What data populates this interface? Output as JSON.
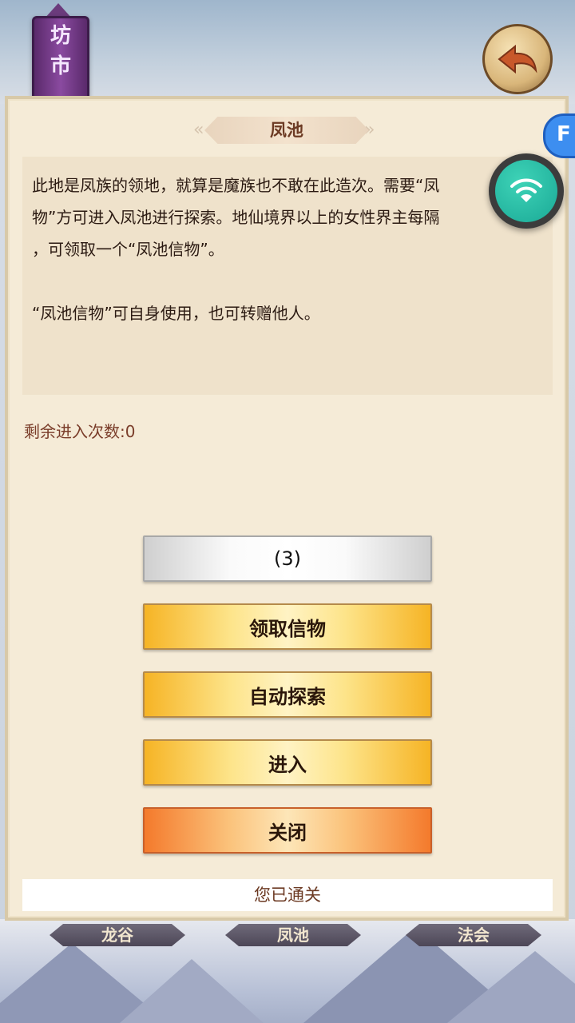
{
  "market_banner": {
    "line1": "坊",
    "line2": "市"
  },
  "back_button": {
    "icon": "back-arrow-icon"
  },
  "dialog": {
    "title": "凤池",
    "description_lines": [
      "此地是凤族的领地，就算是魔族也不敢在此造次。需要“凤",
      "物”方可进入凤池进行探索。地仙境界以上的女性界主每隔",
      "，可领取一个“凤池信物”。",
      "“凤池信物”可自身使用，也可转赠他人。"
    ],
    "remaining_label": "剩余进入次数:",
    "remaining_count": "0",
    "buttons": {
      "countdown": "(3)",
      "claim_token": "领取信物",
      "auto_explore": "自动探索",
      "enter": "进入",
      "close": "关闭"
    },
    "status": "您已通关"
  },
  "map_tabs": [
    "龙谷",
    "凤池",
    "法会"
  ],
  "floating": {
    "wifi_icon": "wifi-icon",
    "assistant_letter": "F"
  },
  "colors": {
    "gold_button": "#f6b425",
    "orange_button": "#f47a2c",
    "panel_bg": "#f5ebd7",
    "title_text": "#6c3a23"
  }
}
